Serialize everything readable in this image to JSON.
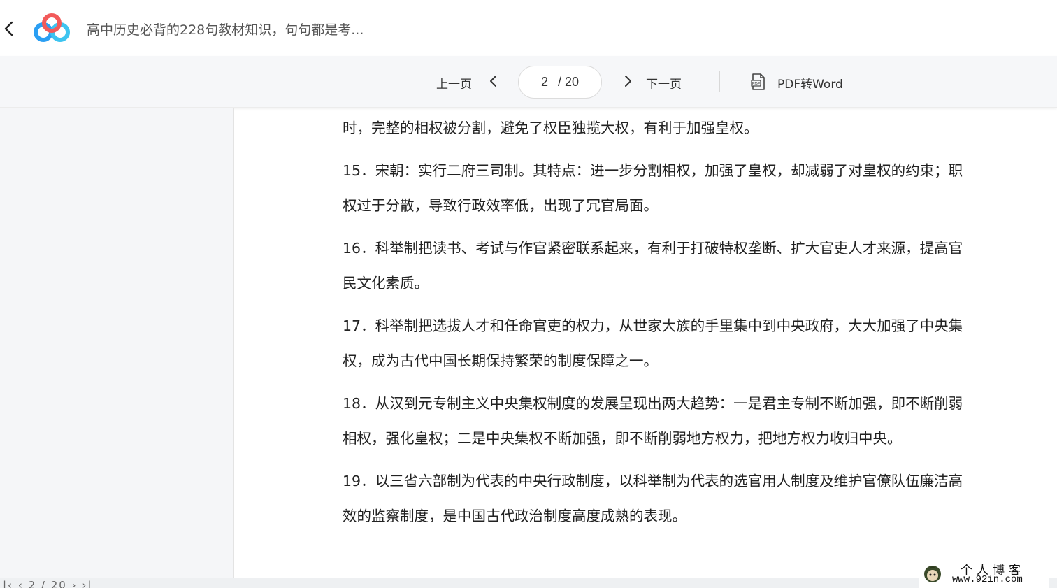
{
  "header": {
    "title": "高中历史必背的228句教材知识，句句都是考..."
  },
  "toolbar": {
    "prev_label": "上一页",
    "next_label": "下一页",
    "current_page": "2",
    "total_pages": "/ 20",
    "convert_label": "PDF转Word"
  },
  "document": {
    "paragraphs": [
      "时，完整的相权被分割，避免了权臣独揽大权，有利于加强皇权。",
      "15．宋朝：实行二府三司制。其特点：进一步分割相权，加强了皇权，却减弱了对皇权的约束；职权过于分散，导致行政效率低，出现了冗官局面。",
      "16．科举制把读书、考试与作官紧密联系起来，有利于打破特权垄断、扩大官吏人才来源，提高官民文化素质。",
      "17．科举制把选拔人才和任命官吏的权力，从世家大族的手里集中到中央政府，大大加强了中央集权，成为古代中国长期保持繁荣的制度保障之一。",
      "18．从汉到元专制主义中央集权制度的发展呈现出两大趋势：一是君主专制不断加强，即不断削弱相权，强化皇权；二是中央集权不断加强，即不断削弱地方权力，把地方权力收归中央。",
      "19．以三省六部制为代表的中央行政制度，以科举制为代表的选官用人制度及维护官僚队伍廉洁高效的监察制度，是中国古代政治制度高度成熟的表现。"
    ]
  },
  "bottom_bar": {
    "controls": "|‹  ‹  2 / 20  ›  ›|"
  },
  "watermark": {
    "line1": "个人博客",
    "line2": "www.92in.com"
  },
  "colors": {
    "accent_blue": "#2b9ff3",
    "accent_red": "#f25a5a",
    "toolbar_bg": "#f6f7f9"
  }
}
